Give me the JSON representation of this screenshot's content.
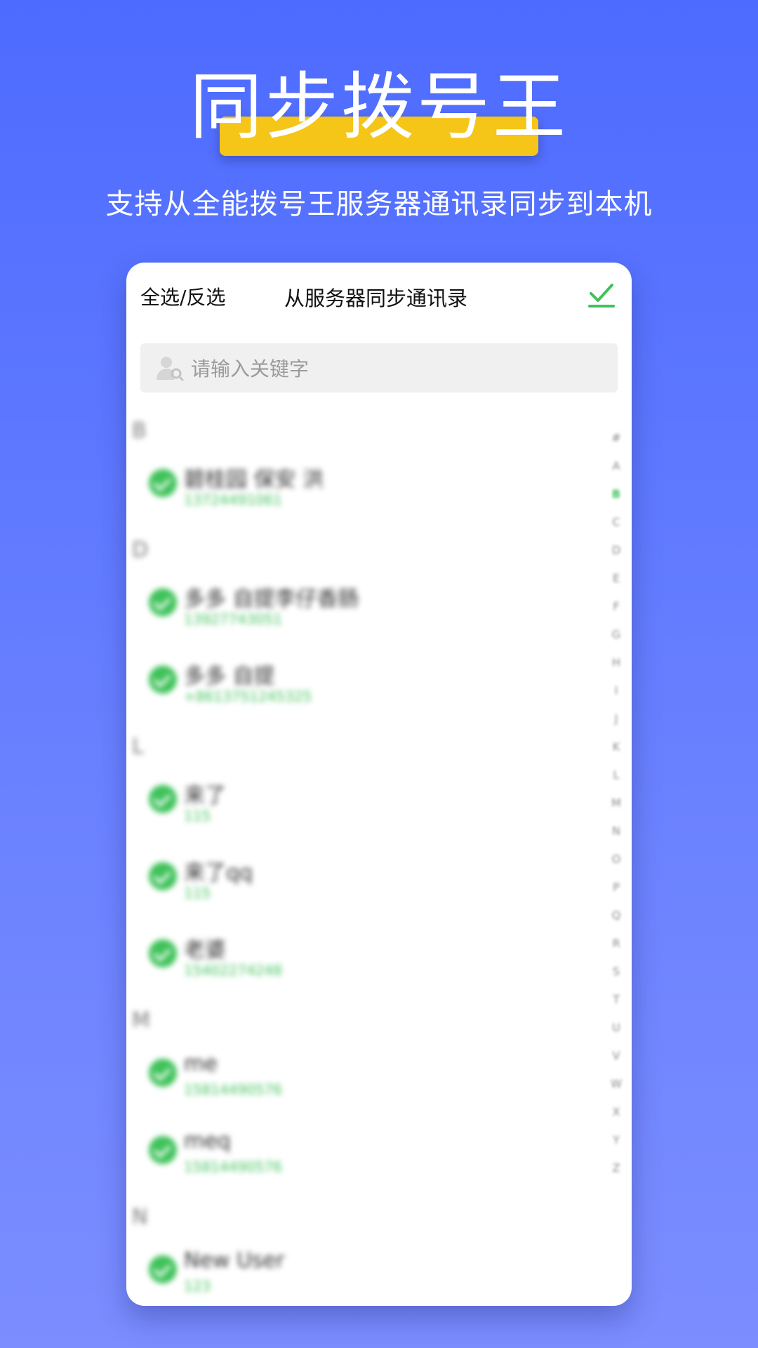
{
  "hero": {
    "title": "同步拨号王",
    "subtitle": "支持从全能拨号王服务器通讯录同步到本机"
  },
  "topbar": {
    "select_all_label": "全选/反选",
    "title": "从服务器同步通讯录",
    "confirm_icon": "checkmark-icon"
  },
  "search": {
    "placeholder": "请输入关键字",
    "icon": "contact-search-icon"
  },
  "contacts": [
    {
      "section": "B",
      "items": [
        {
          "name": "碧桂园 保安 洪",
          "phone": "13724491061"
        }
      ]
    },
    {
      "section": "D",
      "items": [
        {
          "name": "多多 自提李仔香肠",
          "phone": "13927743051"
        },
        {
          "name": "多多 自提",
          "phone": "+8613751245325"
        }
      ]
    },
    {
      "section": "L",
      "items": [
        {
          "name": "来了",
          "phone": "115"
        },
        {
          "name": "来了qq",
          "phone": "115"
        },
        {
          "name": "老婆",
          "phone": "15402274248"
        }
      ]
    },
    {
      "section": "M",
      "items": [
        {
          "name": "me",
          "phone": "15814490576"
        },
        {
          "name": "meq",
          "phone": "15814490576"
        }
      ]
    },
    {
      "section": "N",
      "items": [
        {
          "name": "New User",
          "phone": "123"
        }
      ]
    }
  ],
  "index_letters": [
    "#",
    "A",
    "B",
    "C",
    "D",
    "E",
    "F",
    "G",
    "H",
    "I",
    "J",
    "K",
    "L",
    "M",
    "N",
    "O",
    "P",
    "Q",
    "R",
    "S",
    "T",
    "U",
    "V",
    "W",
    "X",
    "Y",
    "Z"
  ],
  "colors": {
    "accent_green": "#3fc25a",
    "background_blue": "#4d6bff",
    "highlight_yellow": "#f5c518"
  }
}
